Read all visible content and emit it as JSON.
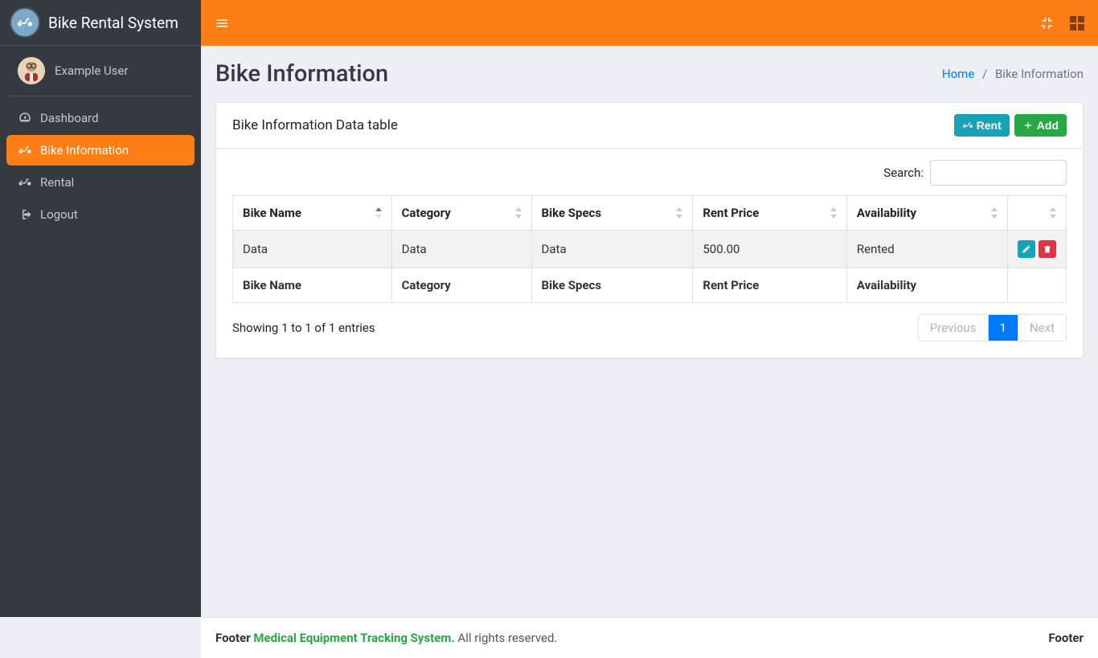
{
  "brand": {
    "title": "Bike Rental System"
  },
  "user": {
    "name": "Example User"
  },
  "sidebar": {
    "items": [
      {
        "label": "Dashboard",
        "active": false
      },
      {
        "label": "Bike Information",
        "active": true
      },
      {
        "label": "Rental",
        "active": false
      },
      {
        "label": "Logout",
        "active": false
      }
    ]
  },
  "page": {
    "title": "Bike Information",
    "breadcrumb": {
      "home": "Home",
      "current": "Bike Information",
      "sep": "/"
    }
  },
  "card": {
    "title": "Bike Information Data table",
    "rent_label": "Rent",
    "add_label": "Add"
  },
  "search": {
    "label": "Search:",
    "value": ""
  },
  "table": {
    "columns": [
      "Bike Name",
      "Category",
      "Bike Specs",
      "Rent Price",
      "Availability",
      ""
    ],
    "rows": [
      {
        "bike_name": "Data",
        "category": "Data",
        "bike_specs": "Data",
        "rent_price": "500.00",
        "availability": "Rented"
      }
    ],
    "footer_columns": [
      "Bike Name",
      "Category",
      "Bike Specs",
      "Rent Price",
      "Availability",
      ""
    ],
    "info": "Showing 1 to 1 of 1 entries"
  },
  "pagination": {
    "previous": "Previous",
    "page": "1",
    "next": "Next"
  },
  "footer": {
    "left_prefix": "Footer ",
    "link_text": "Medical Equipment Tracking System.",
    "rights": " All rights reserved.",
    "right": "Footer"
  }
}
